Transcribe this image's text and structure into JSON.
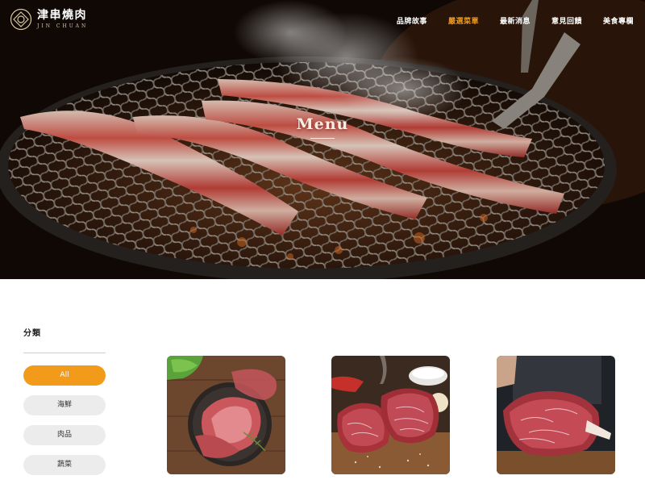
{
  "brand": {
    "name_cn": "津串燒肉",
    "name_en": "JIN CHUAN"
  },
  "nav": {
    "items": [
      {
        "label": "品牌故事",
        "active": false
      },
      {
        "label": "嚴選菜單",
        "active": true
      },
      {
        "label": "最新消息",
        "active": false
      },
      {
        "label": "意見回饋",
        "active": false
      },
      {
        "label": "美食專欄",
        "active": false
      }
    ]
  },
  "hero": {
    "title": "Menu"
  },
  "sidebar": {
    "title": "分類",
    "categories": [
      {
        "label": "All",
        "active": true
      },
      {
        "label": "海鮮",
        "active": false
      },
      {
        "label": "肉品",
        "active": false
      },
      {
        "label": "蔬菜",
        "active": false
      }
    ]
  },
  "products": [
    {
      "image": "cured-ham-platter-photo"
    },
    {
      "image": "marbled-steaks-photo"
    },
    {
      "image": "raw-beef-rib-photo"
    }
  ],
  "colors": {
    "accent": "#f29b1b",
    "category_bg": "#ececec",
    "text_dark": "#222222"
  }
}
